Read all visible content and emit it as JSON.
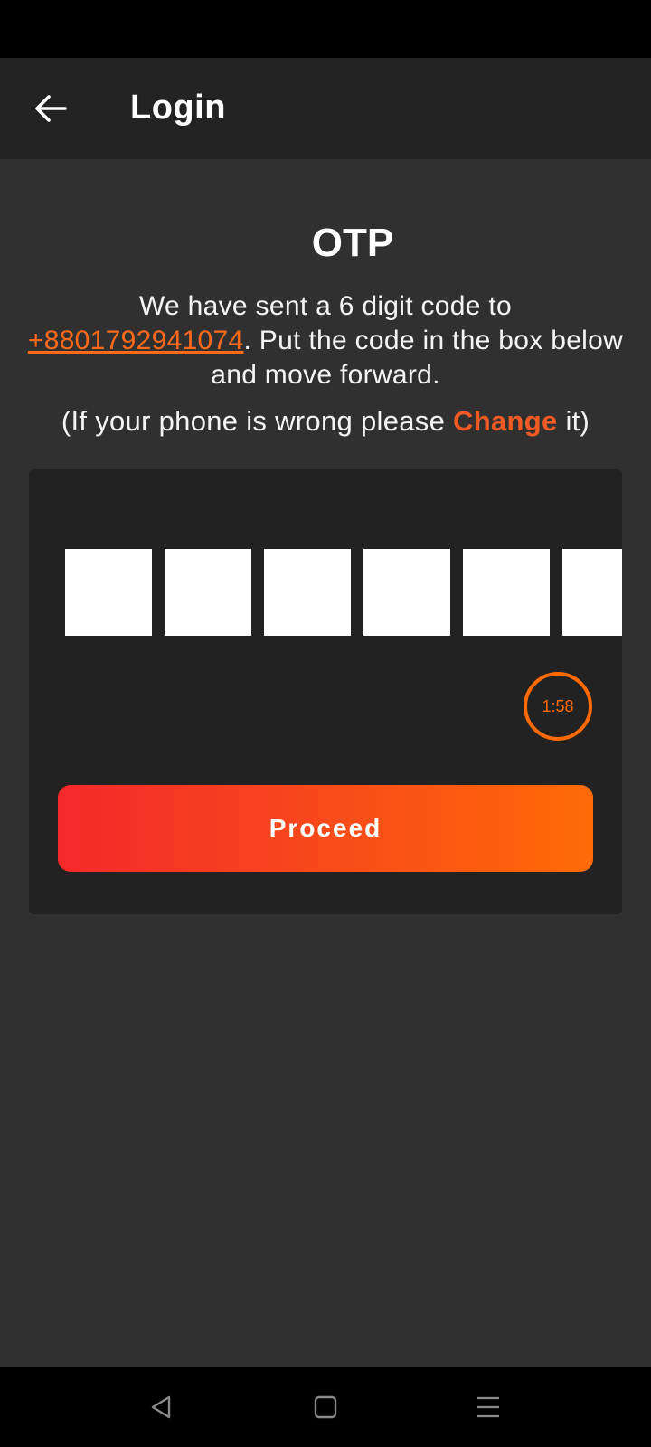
{
  "header": {
    "title": "Login"
  },
  "otp": {
    "heading": "OTP",
    "desc_prefix": "We have sent a 6 digit code to ",
    "phone": "+8801792941074",
    "desc_suffix": ". Put the code in the box below and move forward.",
    "change_prefix": "(If your phone is wrong please ",
    "change_link": "Change",
    "change_suffix": " it)",
    "digits": [
      "",
      "",
      "",
      "",
      "",
      ""
    ],
    "timer": "1:58",
    "proceed_label": "Proceed"
  },
  "colors": {
    "accent": "#ff6a00",
    "gradient_start": "#f5282a",
    "gradient_end": "#ff6a06",
    "background": "#303030",
    "card": "#222222"
  },
  "icons": {
    "back": "arrow-left-icon",
    "nav_back": "triangle-back-icon",
    "nav_home": "square-home-icon",
    "nav_menu": "menu-lines-icon"
  }
}
